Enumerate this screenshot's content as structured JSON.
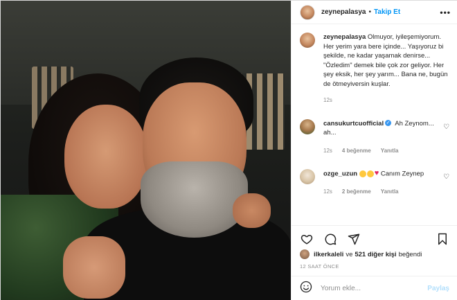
{
  "header": {
    "username": "zeynepalasya",
    "dot": "•",
    "follow_label": "Takip Et",
    "more_label": "•••"
  },
  "caption": {
    "username": "zeynepalasya",
    "text": "Olmuyor, iyileşemiyorum. Her yerim yara bere içinde... Yaşıyoruz bi şekilde, ne kadar yaşamak denirse... \"Özledim\" demek bile çok zor geliyor. Her şey eksik, her şey yarım... Bana ne, bugün de ötmeyiversin kuşlar.",
    "time": "12s"
  },
  "comments": [
    {
      "username": "cansukurtcuofficial",
      "verified": true,
      "text": "Ah Zeynom... ah...",
      "time": "12s",
      "likes": "4 beğenme",
      "reply": "Yanıtla",
      "heart": "♡"
    },
    {
      "username": "ozge_uzun",
      "verified": false,
      "emojis": [
        "sad-face-emoji",
        "sad-face-emoji",
        "red-heart-emoji"
      ],
      "text": "Canım Zeynep",
      "time": "12s",
      "likes": "2 beğenme",
      "reply": "Yanıtla",
      "heart": "♡"
    }
  ],
  "likes": {
    "first_user": "ilkerkaleli",
    "connector": "ve",
    "others": "521 diğer kişi",
    "suffix": "beğendi"
  },
  "post_time": "12 SAAT ÖNCE",
  "add_comment": {
    "placeholder": "Yorum ekle...",
    "post_label": "Paylaş"
  },
  "colors": {
    "accent": "#0095f6",
    "verified": "#3897f0",
    "muted": "#8e8e8e",
    "post_disabled": "#b2dffc"
  }
}
